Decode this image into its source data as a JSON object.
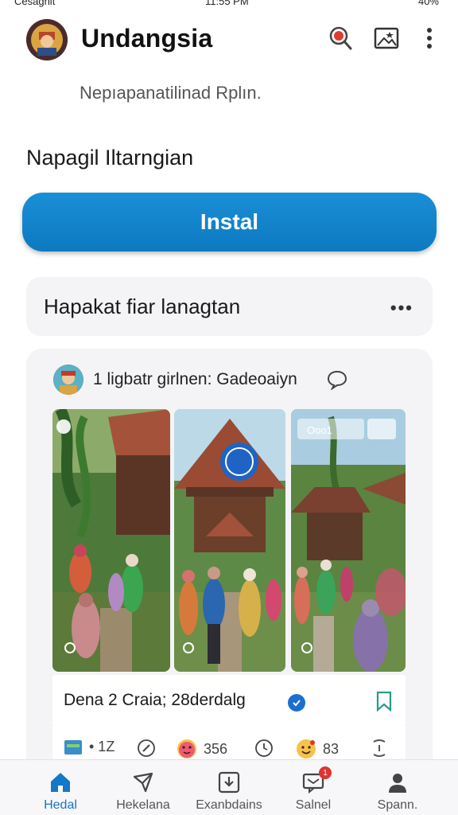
{
  "status_bar": {
    "left": "Cesagnit",
    "time": "11:55 PM",
    "right": "40%"
  },
  "header": {
    "title": "Undangsia"
  },
  "subtitle": "Nepıapanatilinad Rplın.",
  "section_title": "Napagil Iltarngian",
  "install_button": {
    "label": "Instal"
  },
  "row_card": {
    "label": "Hapakat fiar lanagtan",
    "more": "•••"
  },
  "post": {
    "author": "1 ligbatr girlnen: Gadeoaiyn",
    "caption": "Dena 2 Craia; 28derdalg",
    "photo_overlays": {
      "photo3_label": "Ooo1"
    },
    "reactions": [
      {
        "icon": "card-icon",
        "count": "• 1Z"
      },
      {
        "icon": "compass-icon",
        "count": ""
      },
      {
        "icon": "blush-emoji-icon",
        "count": "356"
      },
      {
        "icon": "clock-icon",
        "count": ""
      },
      {
        "icon": "smile-emoji-icon",
        "count": "83"
      },
      {
        "icon": "link-icon",
        "count": ""
      }
    ]
  },
  "bottom_nav": [
    {
      "label": "Hedal",
      "icon": "home-icon",
      "active": true
    },
    {
      "label": "Hekelana",
      "icon": "send-icon",
      "active": false
    },
    {
      "label": "Exanbdains",
      "icon": "download-icon",
      "active": false
    },
    {
      "label": "Salnel",
      "icon": "message-icon",
      "active": false,
      "badge": "1"
    },
    {
      "label": "Spann.",
      "icon": "profile-icon",
      "active": false
    }
  ],
  "colors": {
    "accent": "#0d79c1",
    "nav_active": "#1477c8",
    "card_bg": "#f4f4f6",
    "badge": "#e0332b"
  }
}
